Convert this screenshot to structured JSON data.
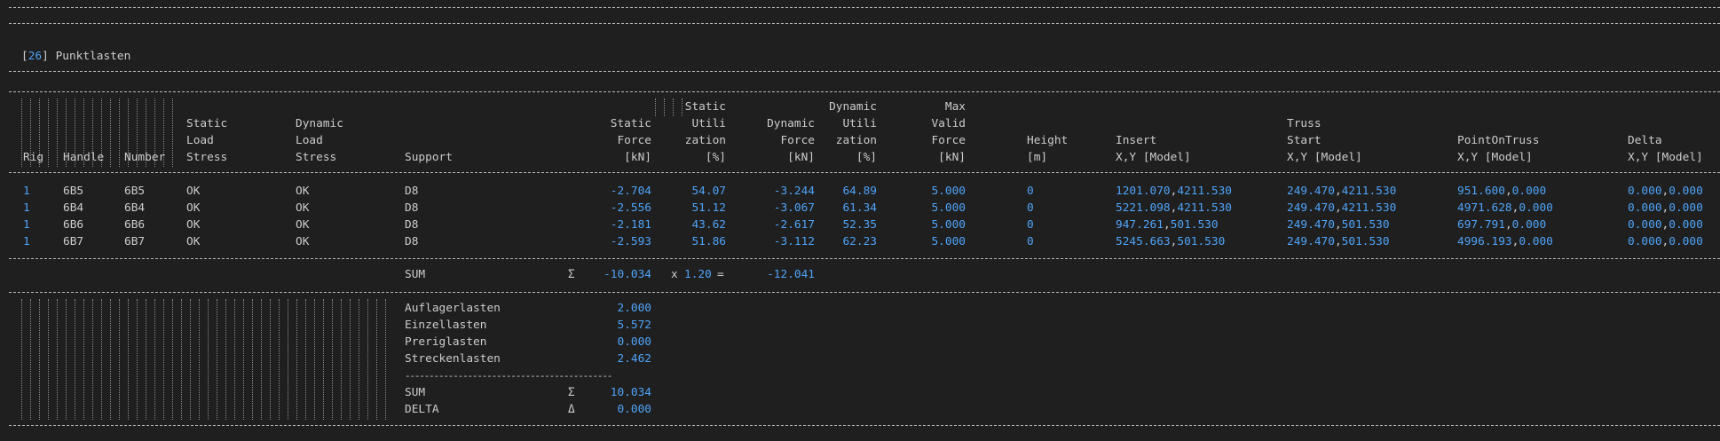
{
  "section": {
    "id": "26",
    "title": "Punktlasten"
  },
  "headers": {
    "rig": "Rig",
    "handle": "Handle",
    "number": "Number",
    "static_load_stress": [
      "Static",
      "Load",
      "Stress"
    ],
    "dynamic_load_stress": [
      "Dynamic",
      "Load",
      "Stress"
    ],
    "support": "Support",
    "static_force": [
      "Static",
      "Force",
      "[kN]"
    ],
    "static_util": [
      "Static",
      "Utili",
      "zation",
      "[%]"
    ],
    "dynamic_force": [
      "Dynamic",
      "Force",
      "[kN]"
    ],
    "dynamic_util": [
      "Dynamic",
      "Utili",
      "zation",
      "[%]"
    ],
    "max_valid_force": [
      "Max",
      "Valid",
      "Force",
      "[kN]"
    ],
    "height": [
      "Height",
      "[m]"
    ],
    "insert": [
      "Insert",
      "X,Y [Model]"
    ],
    "truss_start": [
      "Truss",
      "Start",
      "X,Y [Model]"
    ],
    "point_on_truss": [
      "PointOnTruss",
      "X,Y [Model]"
    ],
    "delta": [
      "Delta",
      "X,Y [Model]"
    ]
  },
  "rows": [
    {
      "rig": "1",
      "handle": "6B5",
      "number": "6B5",
      "sls": "OK",
      "dls": "OK",
      "support": "D8",
      "sf": "-2.704",
      "su": "54.07",
      "df": "-3.244",
      "du": "64.89",
      "mvf": "5.000",
      "h": "0",
      "ins_x": "1201.070",
      "ins_y": "4211.530",
      "ts_x": "249.470",
      "ts_y": "4211.530",
      "pot_x": "951.600",
      "pot_y": "0.000",
      "d_x": "0.000",
      "d_y": "0.000"
    },
    {
      "rig": "1",
      "handle": "6B4",
      "number": "6B4",
      "sls": "OK",
      "dls": "OK",
      "support": "D8",
      "sf": "-2.556",
      "su": "51.12",
      "df": "-3.067",
      "du": "61.34",
      "mvf": "5.000",
      "h": "0",
      "ins_x": "5221.098",
      "ins_y": "4211.530",
      "ts_x": "249.470",
      "ts_y": "4211.530",
      "pot_x": "4971.628",
      "pot_y": "0.000",
      "d_x": "0.000",
      "d_y": "0.000"
    },
    {
      "rig": "1",
      "handle": "6B6",
      "number": "6B6",
      "sls": "OK",
      "dls": "OK",
      "support": "D8",
      "sf": "-2.181",
      "su": "43.62",
      "df": "-2.617",
      "du": "52.35",
      "mvf": "5.000",
      "h": "0",
      "ins_x": "947.261",
      "ins_y": "501.530",
      "ts_x": "249.470",
      "ts_y": "501.530",
      "pot_x": "697.791",
      "pot_y": "0.000",
      "d_x": "0.000",
      "d_y": "0.000"
    },
    {
      "rig": "1",
      "handle": "6B7",
      "number": "6B7",
      "sls": "OK",
      "dls": "OK",
      "support": "D8",
      "sf": "-2.593",
      "su": "51.86",
      "df": "-3.112",
      "du": "62.23",
      "mvf": "5.000",
      "h": "0",
      "ins_x": "5245.663",
      "ins_y": "501.530",
      "ts_x": "249.470",
      "ts_y": "501.530",
      "pot_x": "4996.193",
      "pot_y": "0.000",
      "d_x": "0.000",
      "d_y": "0.000"
    }
  ],
  "sum_line": {
    "label": "SUM",
    "symbol": "Σ",
    "value": "-10.034",
    "mult_prefix": "x",
    "factor": "1.20",
    "equals": "=",
    "result": "-12.041"
  },
  "breakdown": {
    "items": [
      {
        "label": "Auflagerlasten",
        "value": "2.000"
      },
      {
        "label": "Einzellasten",
        "value": "5.572"
      },
      {
        "label": "Preriglasten",
        "value": "0.000"
      },
      {
        "label": "Streckenlasten",
        "value": "2.462"
      }
    ],
    "separator": "-------------------------------------------",
    "sum": {
      "label": "SUM",
      "symbol": "Σ",
      "value": "10.034"
    },
    "delta": {
      "label": "DELTA",
      "symbol": "Δ",
      "value": "0.000"
    }
  },
  "colors": {
    "background": "#1f1f1f",
    "text": "#cccccc",
    "number": "#4fa3f7",
    "divider": "#b8b8b8"
  }
}
